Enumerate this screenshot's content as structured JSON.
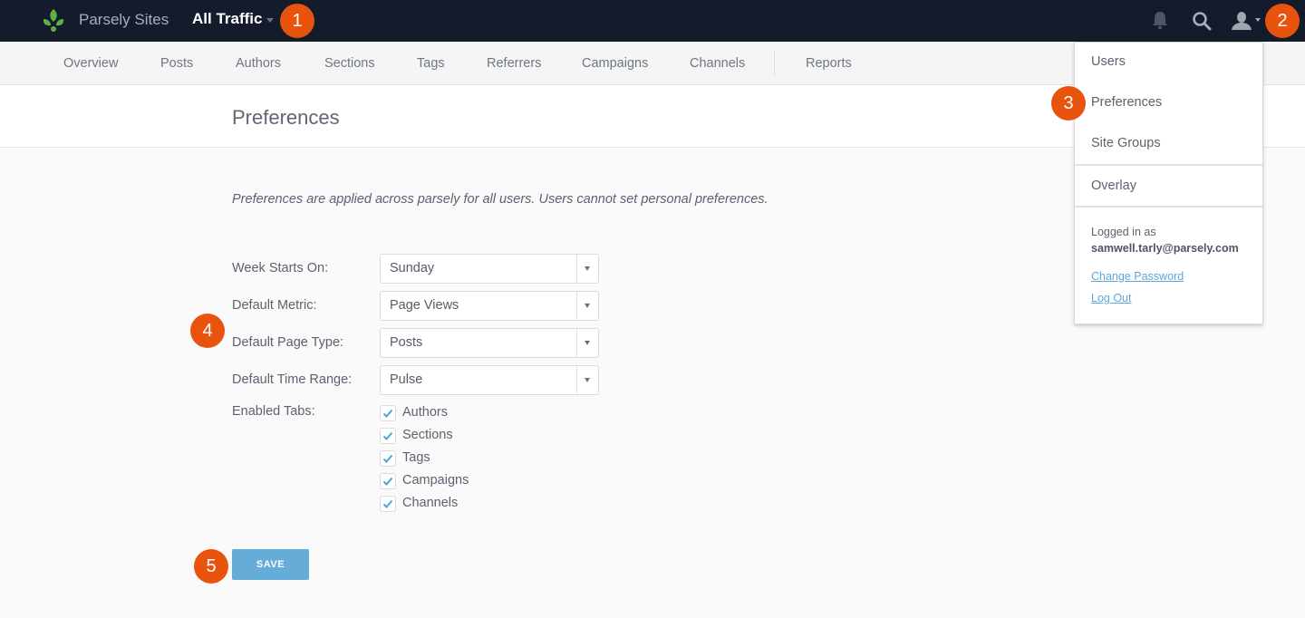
{
  "topbar": {
    "brand": "Parsely Sites",
    "site_selector": "All Traffic",
    "icons": [
      "parsely-logo-icon",
      "bell-icon",
      "search-icon",
      "user-icon"
    ]
  },
  "nav": {
    "items": [
      {
        "label": "Overview"
      },
      {
        "label": "Posts"
      },
      {
        "label": "Authors"
      },
      {
        "label": "Sections"
      },
      {
        "label": "Tags"
      },
      {
        "label": "Referrers"
      },
      {
        "label": "Campaigns"
      },
      {
        "label": "Channels"
      },
      {
        "label": "Reports"
      }
    ]
  },
  "page": {
    "title": "Preferences",
    "note": "Preferences are applied across parsely for all users. Users cannot set personal preferences."
  },
  "form": {
    "selects": [
      {
        "label": "Week Starts On:",
        "value": "Sunday"
      },
      {
        "label": "Default Metric:",
        "value": "Page Views"
      },
      {
        "label": "Default Page Type:",
        "value": "Posts"
      },
      {
        "label": "Default Time Range:",
        "value": "Pulse"
      }
    ],
    "enabled_tabs_label": "Enabled Tabs:",
    "enabled_tabs": [
      {
        "label": "Authors",
        "checked": true
      },
      {
        "label": "Sections",
        "checked": true
      },
      {
        "label": "Tags",
        "checked": true
      },
      {
        "label": "Campaigns",
        "checked": true
      },
      {
        "label": "Channels",
        "checked": true
      }
    ],
    "save_label": "SAVE"
  },
  "user_menu": {
    "items": [
      "Users",
      "Preferences",
      "Site Groups"
    ],
    "overlay": "Overlay",
    "logged_in_label": "Logged in as",
    "email": "samwell.tarly@parsely.com",
    "change_password": "Change Password",
    "log_out": "Log Out"
  },
  "annotations": [
    "1",
    "2",
    "3",
    "4",
    "5"
  ],
  "colors": {
    "topbar": "#141b2b",
    "accent": "#66acd8",
    "badge": "#e8540e",
    "logo": "#5cb046",
    "link": "#5aa7db"
  }
}
